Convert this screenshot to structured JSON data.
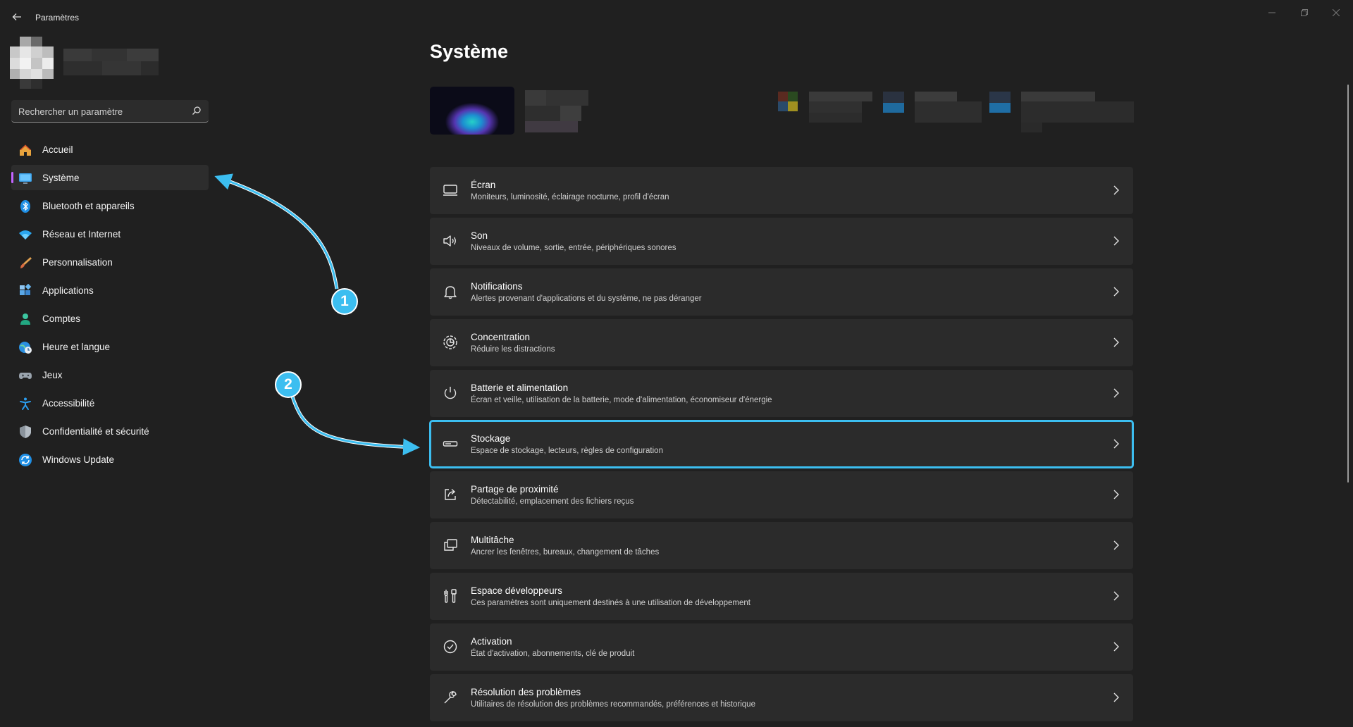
{
  "window": {
    "title": "Paramètres"
  },
  "search": {
    "placeholder": "Rechercher un paramètre"
  },
  "sidebar": {
    "items": [
      {
        "label": "Accueil"
      },
      {
        "label": "Système"
      },
      {
        "label": "Bluetooth et appareils"
      },
      {
        "label": "Réseau et Internet"
      },
      {
        "label": "Personnalisation"
      },
      {
        "label": "Applications"
      },
      {
        "label": "Comptes"
      },
      {
        "label": "Heure et langue"
      },
      {
        "label": "Jeux"
      },
      {
        "label": "Accessibilité"
      },
      {
        "label": "Confidentialité et sécurité"
      },
      {
        "label": "Windows Update"
      }
    ]
  },
  "main": {
    "title": "Système",
    "cards": [
      {
        "title": "Écran",
        "subtitle": "Moniteurs, luminosité, éclairage nocturne, profil d'écran",
        "icon": "monitor-icon"
      },
      {
        "title": "Son",
        "subtitle": "Niveaux de volume, sortie, entrée, périphériques sonores",
        "icon": "speaker-icon"
      },
      {
        "title": "Notifications",
        "subtitle": "Alertes provenant d'applications et du système, ne pas déranger",
        "icon": "bell-icon"
      },
      {
        "title": "Concentration",
        "subtitle": "Réduire les distractions",
        "icon": "focus-icon"
      },
      {
        "title": "Batterie et alimentation",
        "subtitle": "Écran et veille, utilisation de la batterie, mode d'alimentation, économiseur d'énergie",
        "icon": "power-icon"
      },
      {
        "title": "Stockage",
        "subtitle": "Espace de stockage, lecteurs, règles de configuration",
        "icon": "storage-icon"
      },
      {
        "title": "Partage de proximité",
        "subtitle": "Détectabilité, emplacement des fichiers reçus",
        "icon": "share-icon"
      },
      {
        "title": "Multitâche",
        "subtitle": "Ancrer les fenêtres, bureaux, changement de tâches",
        "icon": "multitask-icon"
      },
      {
        "title": "Espace développeurs",
        "subtitle": "Ces paramètres sont uniquement destinés à une utilisation de développement",
        "icon": "developer-tools-icon"
      },
      {
        "title": "Activation",
        "subtitle": "État d'activation, abonnements, clé de produit",
        "icon": "check-circle-icon"
      },
      {
        "title": "Résolution des problèmes",
        "subtitle": "Utilitaires de résolution des problèmes recommandés, préférences et historique",
        "icon": "wrench-icon"
      }
    ]
  },
  "annotations": [
    {
      "label": "1"
    },
    {
      "label": "2"
    }
  ],
  "colors": {
    "accent": "#3cbef0",
    "background": "#202020",
    "card": "#2b2b2b",
    "active_indicator": "#c264ff"
  }
}
